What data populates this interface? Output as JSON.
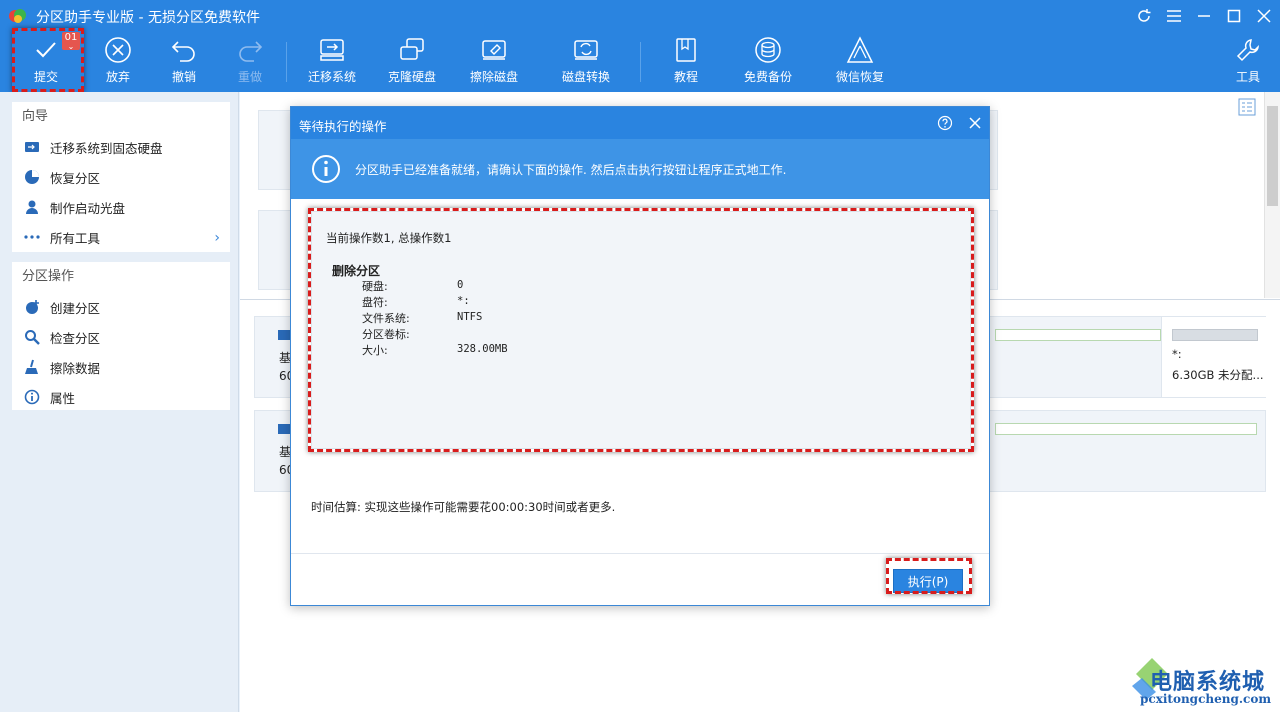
{
  "app": {
    "title": "分区助手专业版 - 无损分区免费软件"
  },
  "toolbar": {
    "commit_label": "提交",
    "commit_badge": "01",
    "discard_label": "放弃",
    "undo_label": "撤销",
    "redo_label": "重做",
    "migrate_label": "迁移系统",
    "clone_label": "克隆硬盘",
    "wipe_label": "擦除磁盘",
    "convert_label": "磁盘转换",
    "tutorial_label": "教程",
    "backup_label": "免费备份",
    "wechat_label": "微信恢复",
    "tools_label": "工具"
  },
  "sidebar": {
    "wizard": {
      "title": "向导",
      "items": [
        {
          "label": "迁移系统到固态硬盘"
        },
        {
          "label": "恢复分区"
        },
        {
          "label": "制作启动光盘"
        },
        {
          "label": "所有工具"
        }
      ]
    },
    "partition_ops": {
      "title": "分区操作",
      "items": [
        {
          "label": "创建分区"
        },
        {
          "label": "检查分区"
        },
        {
          "label": "擦除数据"
        },
        {
          "label": "属性"
        }
      ]
    }
  },
  "main": {
    "disk1_partial": "基",
    "disk1_size_partial": "60",
    "disk2_partial": "基",
    "disk2_size_partial": "60",
    "unalloc_letter": "*:",
    "unalloc_label": "6.30GB 未分配..."
  },
  "dialog": {
    "title": "等待执行的操作",
    "info": "分区助手已经准备就绪，请确认下面的操作. 然后点击执行按钮让程序正式地工作.",
    "counts": "当前操作数1, 总操作数1",
    "operation_title": "删除分区",
    "fields": [
      {
        "label": "硬盘:",
        "value": "0"
      },
      {
        "label": "盘符:",
        "value": "*:"
      },
      {
        "label": "文件系统:",
        "value": "NTFS"
      },
      {
        "label": "分区卷标:",
        "value": ""
      },
      {
        "label": "大小:",
        "value": "328.00MB"
      }
    ],
    "estimate": "时间估算: 实现这些操作可能需要花00:00:30时间或者更多.",
    "execute_label": "执行(P)"
  },
  "watermark": {
    "cn": "电脑系统城",
    "en": "pcxitongcheng.com"
  },
  "colors": {
    "accent": "#2a84e0",
    "highlight": "#d81c1c"
  }
}
